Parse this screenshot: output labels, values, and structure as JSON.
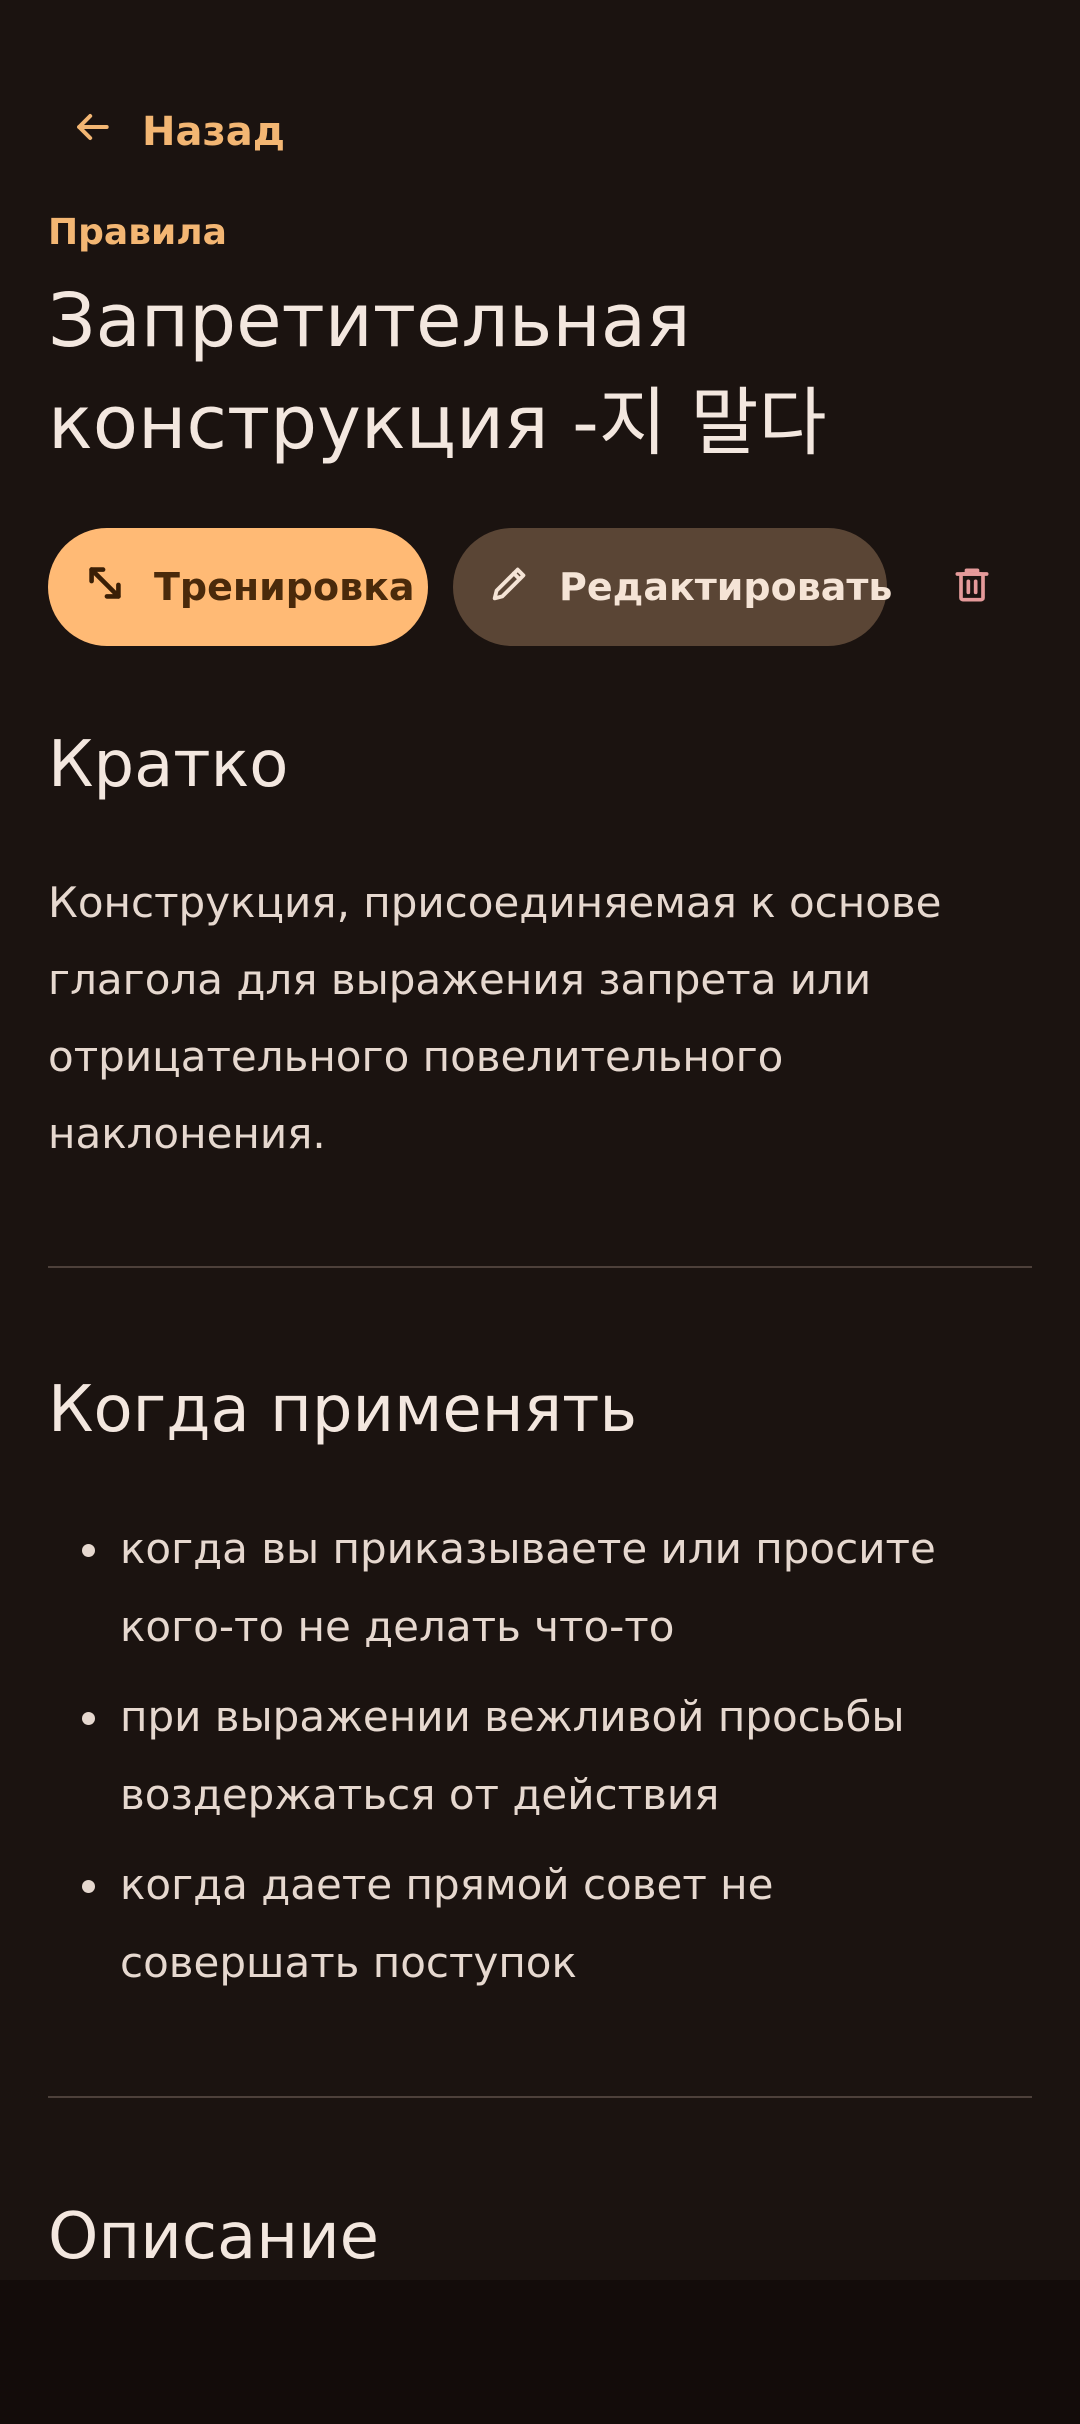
{
  "header": {
    "back_label": "Назад"
  },
  "rule": {
    "category": "Правила",
    "title": "Запретительная конструкция -지 말다"
  },
  "actions": {
    "train_label": "Тренировка",
    "edit_label": "Редактировать"
  },
  "sections": {
    "summary": {
      "heading": "Кратко",
      "text": "Конструкция, присоединяемая к основе глагола для выражения запрета или отрицательного повелительного наклонения."
    },
    "usage": {
      "heading": "Когда применять",
      "items": [
        "когда вы приказываете или просите кого-то не делать что-то",
        "при выражении вежливой просьбы воздержаться от действия",
        "когда даете прямой совет не совершать поступок"
      ]
    },
    "description": {
      "heading": "Описание"
    }
  },
  "colors": {
    "background": "#1b1310",
    "accent": "#f3b673",
    "primary_button": "#ffba75",
    "secondary_button": "#5a4535",
    "delete_icon": "#e59a9a"
  },
  "icons": {
    "back": "arrow-left-icon",
    "train": "resize-diagonal-icon",
    "edit": "pencil-icon",
    "delete": "trash-icon"
  }
}
